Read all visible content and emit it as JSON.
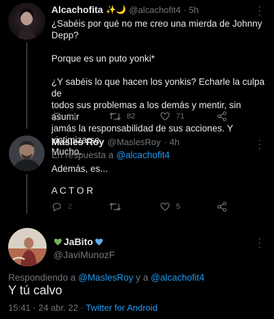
{
  "tweet1": {
    "display_name": "Alcachofita",
    "name_emojis": "✨🌙",
    "handle": "@alcachofit4",
    "dot_time": "· 5h",
    "lines": [
      "¿Sabéis por qué no me creo una mierda de Johnny Depp?",
      "",
      "Porque es un puto yonki*",
      "",
      "¿Y sabéis lo que hacen los yonkis? Echarle la culpa de",
      "todos sus problemas a los demás y mentir, sin asumir",
      "jamás la responsabilidad de sus acciones. Y victimizarse.",
      "Mucho."
    ],
    "replies": "24",
    "retweets": "82",
    "likes": "71"
  },
  "tweet2": {
    "display_name": "Masles Roy",
    "handle": "@MaslesRoy",
    "dot_time": "· 4h",
    "reply_prefix": "En respuesta a",
    "reply_to": "@alcachofit4",
    "line1": "Además, es...",
    "line2": "A C T O R",
    "replies": "2",
    "likes": "5"
  },
  "tweet3": {
    "display_name": "JaBito",
    "handle": "@JaviMunozF",
    "replying_prefix": "Respondiendo a",
    "replying_user1": "@MaslesRoy",
    "replying_and": "y a",
    "replying_user2": "@alcachofit4",
    "text": "Y tú calvo",
    "time": "15:41",
    "date": "· 24 abr. 22 ·",
    "source": "Twitter for Android"
  },
  "icons": [
    "reply-icon",
    "retweet-icon",
    "like-icon",
    "share-icon",
    "more-icon",
    "green-heart-icon",
    "blue-heart-icon"
  ],
  "colors": {
    "link": "#1d9bf0",
    "muted": "#71767b",
    "text": "#e7e9ea",
    "background": "#000000"
  }
}
